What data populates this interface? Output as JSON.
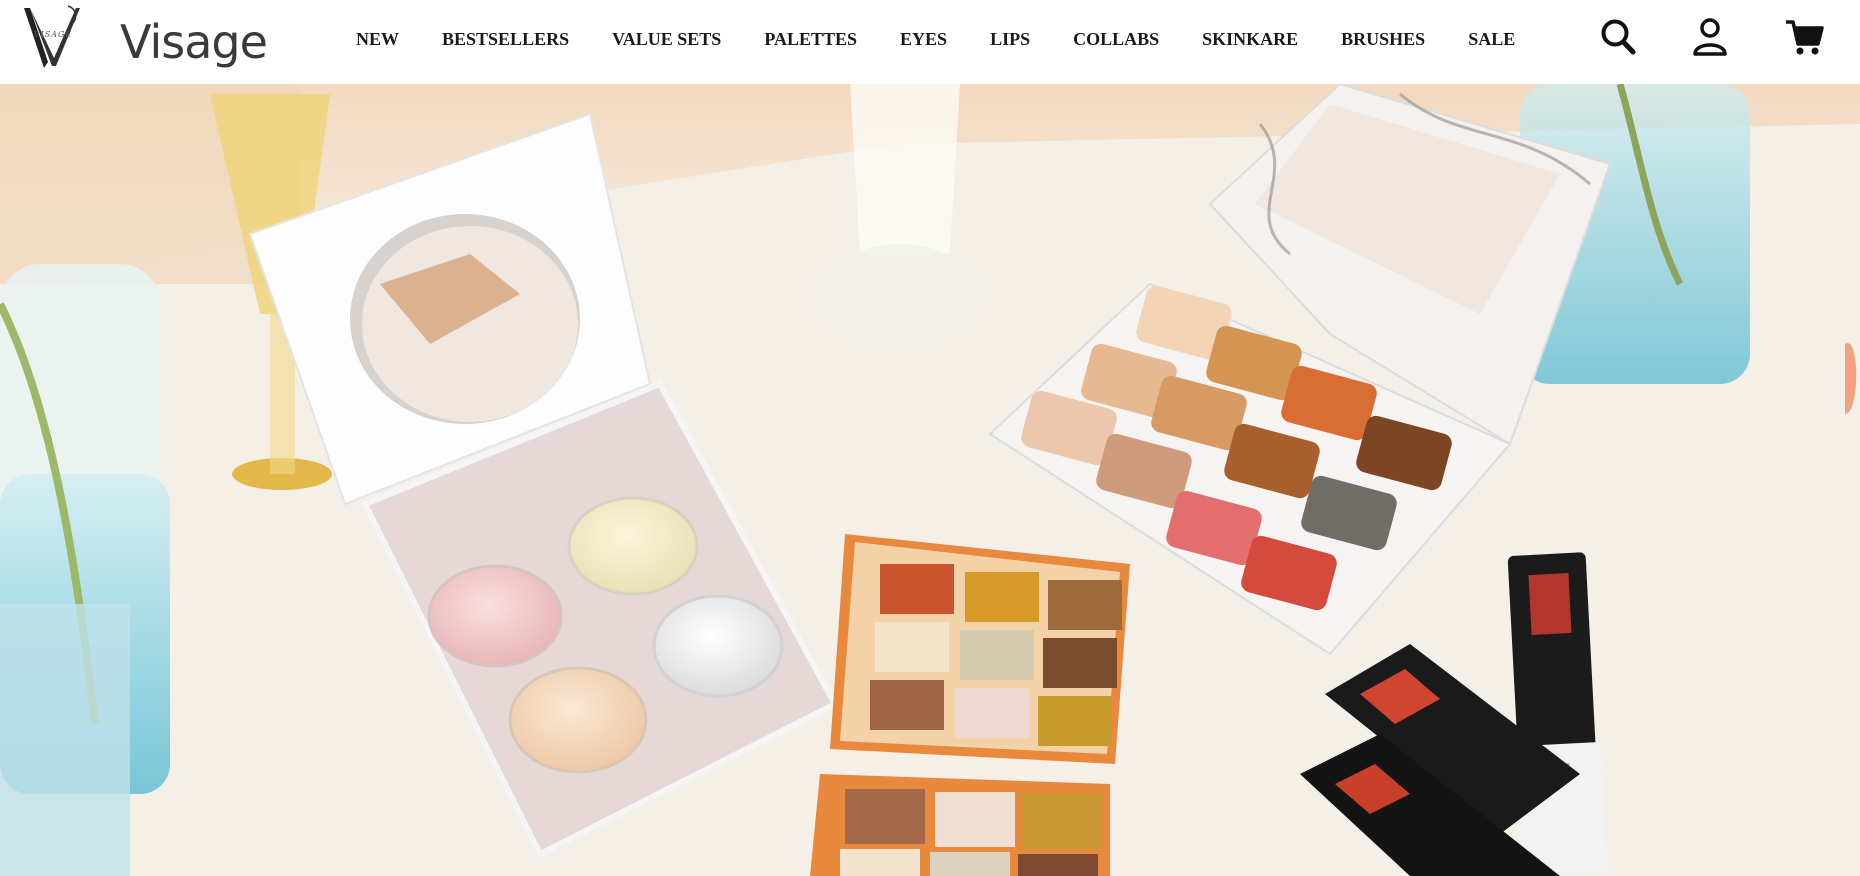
{
  "brand": {
    "name": "Visage",
    "logo_letter": "V",
    "logo_small_text": "VISAGE"
  },
  "nav": {
    "items": [
      {
        "label": "NEW"
      },
      {
        "label": "BESTSELLERS"
      },
      {
        "label": "VALUE SETS"
      },
      {
        "label": "PALETTES"
      },
      {
        "label": "EYES"
      },
      {
        "label": "LIPS"
      },
      {
        "label": "COLLABS"
      },
      {
        "label": "SKINKARE"
      },
      {
        "label": "BRUSHES"
      },
      {
        "label": "SALE"
      }
    ]
  },
  "header_icons": [
    "search-icon",
    "account-icon",
    "cart-icon"
  ],
  "colors": {
    "header_bg": "#ffffff",
    "nav_text": "#1a1a1a",
    "brand_text": "#3a3a3a",
    "hero_table": "#f3eee6"
  }
}
